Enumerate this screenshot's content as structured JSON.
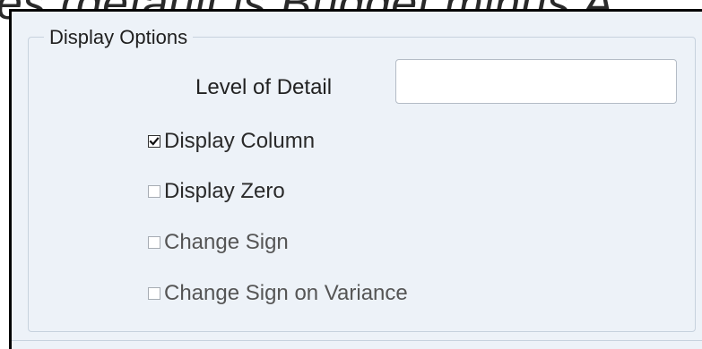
{
  "background_caption": "es (default is Budget minus A",
  "display_options": {
    "legend": "Display Options",
    "level_of_detail": {
      "label": "Level of Detail",
      "value": "",
      "placeholder": ""
    },
    "checkboxes": [
      {
        "label": "Display Column",
        "checked": true
      },
      {
        "label": "Display Zero",
        "checked": false
      },
      {
        "label": "Change Sign",
        "checked": false
      },
      {
        "label": "Change Sign on Variance",
        "checked": false
      }
    ]
  },
  "colors": {
    "panel_background": "#edf2f8",
    "border": "#000000",
    "fieldset_line": "#c7d2de"
  }
}
